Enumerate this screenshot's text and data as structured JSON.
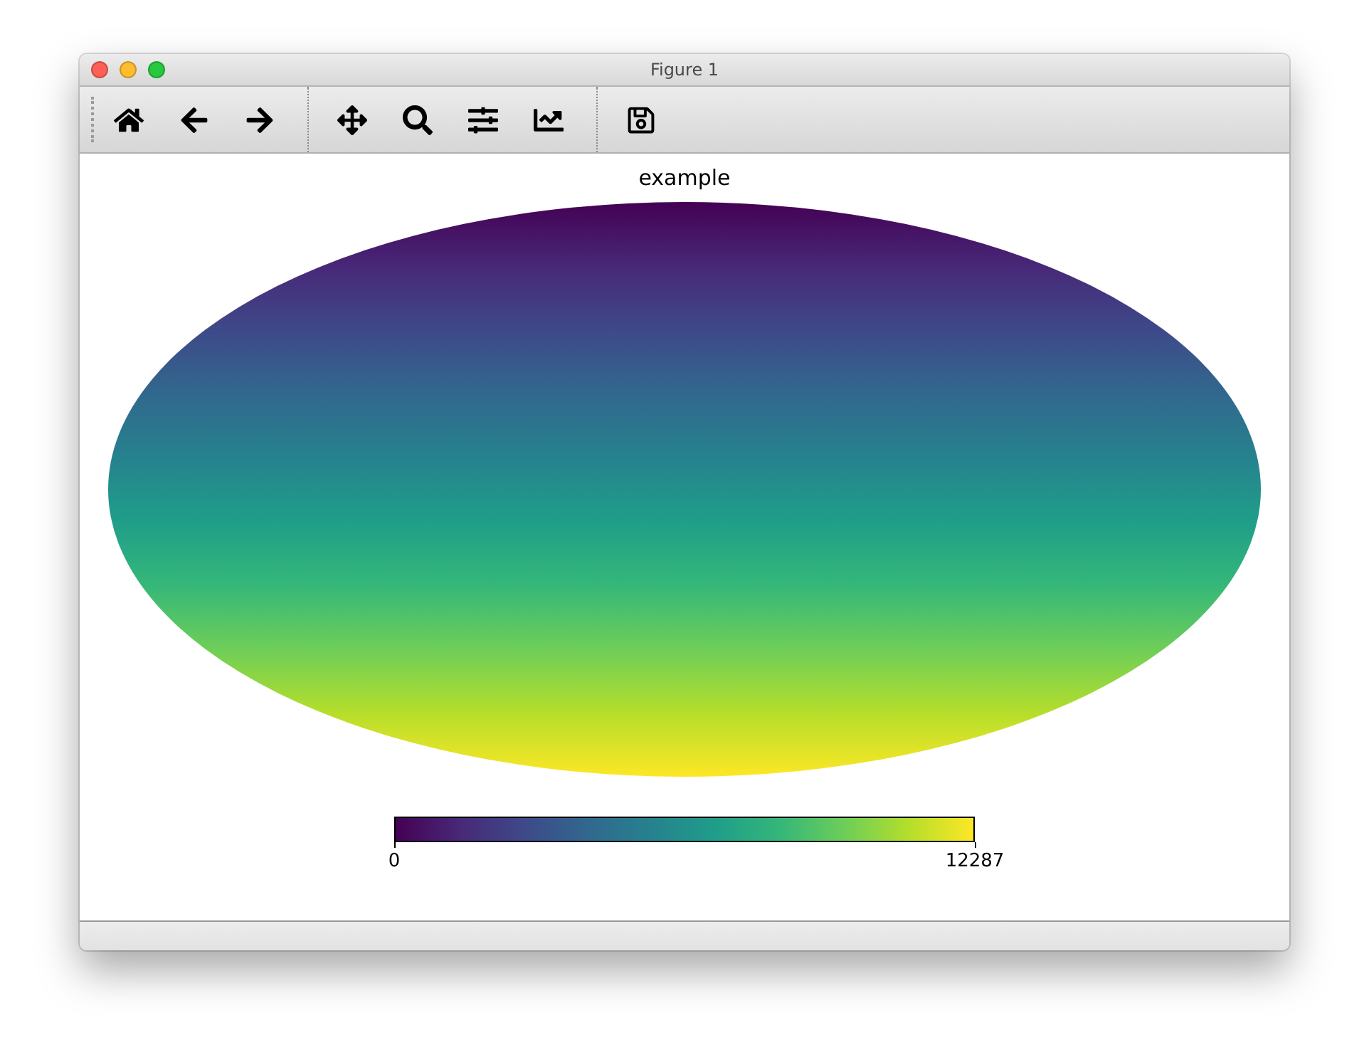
{
  "window": {
    "title": "Figure 1"
  },
  "toolbar": {
    "groups": [
      [
        {
          "kind": "home"
        },
        {
          "kind": "back"
        },
        {
          "kind": "forward"
        }
      ],
      [
        {
          "kind": "pan"
        },
        {
          "kind": "zoom"
        },
        {
          "kind": "configure"
        },
        {
          "kind": "lines"
        }
      ],
      [
        {
          "kind": "save"
        }
      ]
    ]
  },
  "plot": {
    "title": "example",
    "colorbar": {
      "ticks": [
        "0",
        "12287"
      ]
    }
  }
}
